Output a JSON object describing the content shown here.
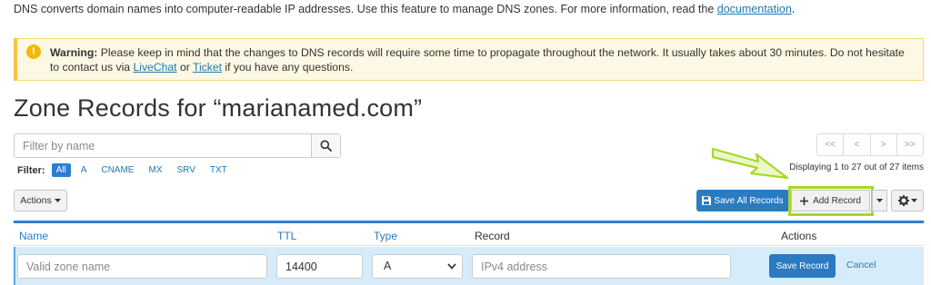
{
  "intro": {
    "text": "DNS converts domain names into computer-readable IP addresses. Use this feature to manage DNS zones. For more information, read the ",
    "link": "documentation",
    "end": "."
  },
  "warning": {
    "label": "Warning:",
    "text1": " Please keep in mind that the changes to DNS records will require some time to propagate throughout the network. It usually takes about 30 minutes. Do not hesitate to contact us via ",
    "link1": "LiveChat",
    "mid": " or ",
    "link2": "Ticket",
    "text2": " if you have any questions.",
    "icon": "exclamation-icon"
  },
  "page": {
    "title": "Zone Records for “marianamed.com”"
  },
  "search": {
    "placeholder": "Filter by name",
    "icon": "search-icon"
  },
  "filter": {
    "label": "Filter:",
    "options": [
      "All",
      "A",
      "CNAME",
      "MX",
      "SRV",
      "TXT"
    ],
    "active": "All"
  },
  "pager": {
    "first": "<<",
    "prev": "<",
    "next": ">",
    "last": ">>"
  },
  "displaying": "Displaying 1 to 27 out of 27 items",
  "toolbar": {
    "actions": "Actions",
    "save_all": "Save All Records",
    "add_record": "Add Record",
    "save_icon": "floppy-disk-icon",
    "add_icon": "plus-icon",
    "gear_icon": "gear-icon"
  },
  "table": {
    "headers": [
      "Name",
      "TTL",
      "Type",
      "Record",
      "Actions"
    ]
  },
  "edit_row": {
    "name_placeholder": "Valid zone name",
    "ttl_value": "14400",
    "type_value": "A",
    "record_placeholder": "IPv4 address",
    "save": "Save Record",
    "cancel": "Cancel"
  },
  "colors": {
    "accent": "#2a7bc0",
    "warning_bg": "#fcf8e3",
    "highlight": "#a8d82a",
    "edit_row_bg": "#d6ecfa"
  }
}
